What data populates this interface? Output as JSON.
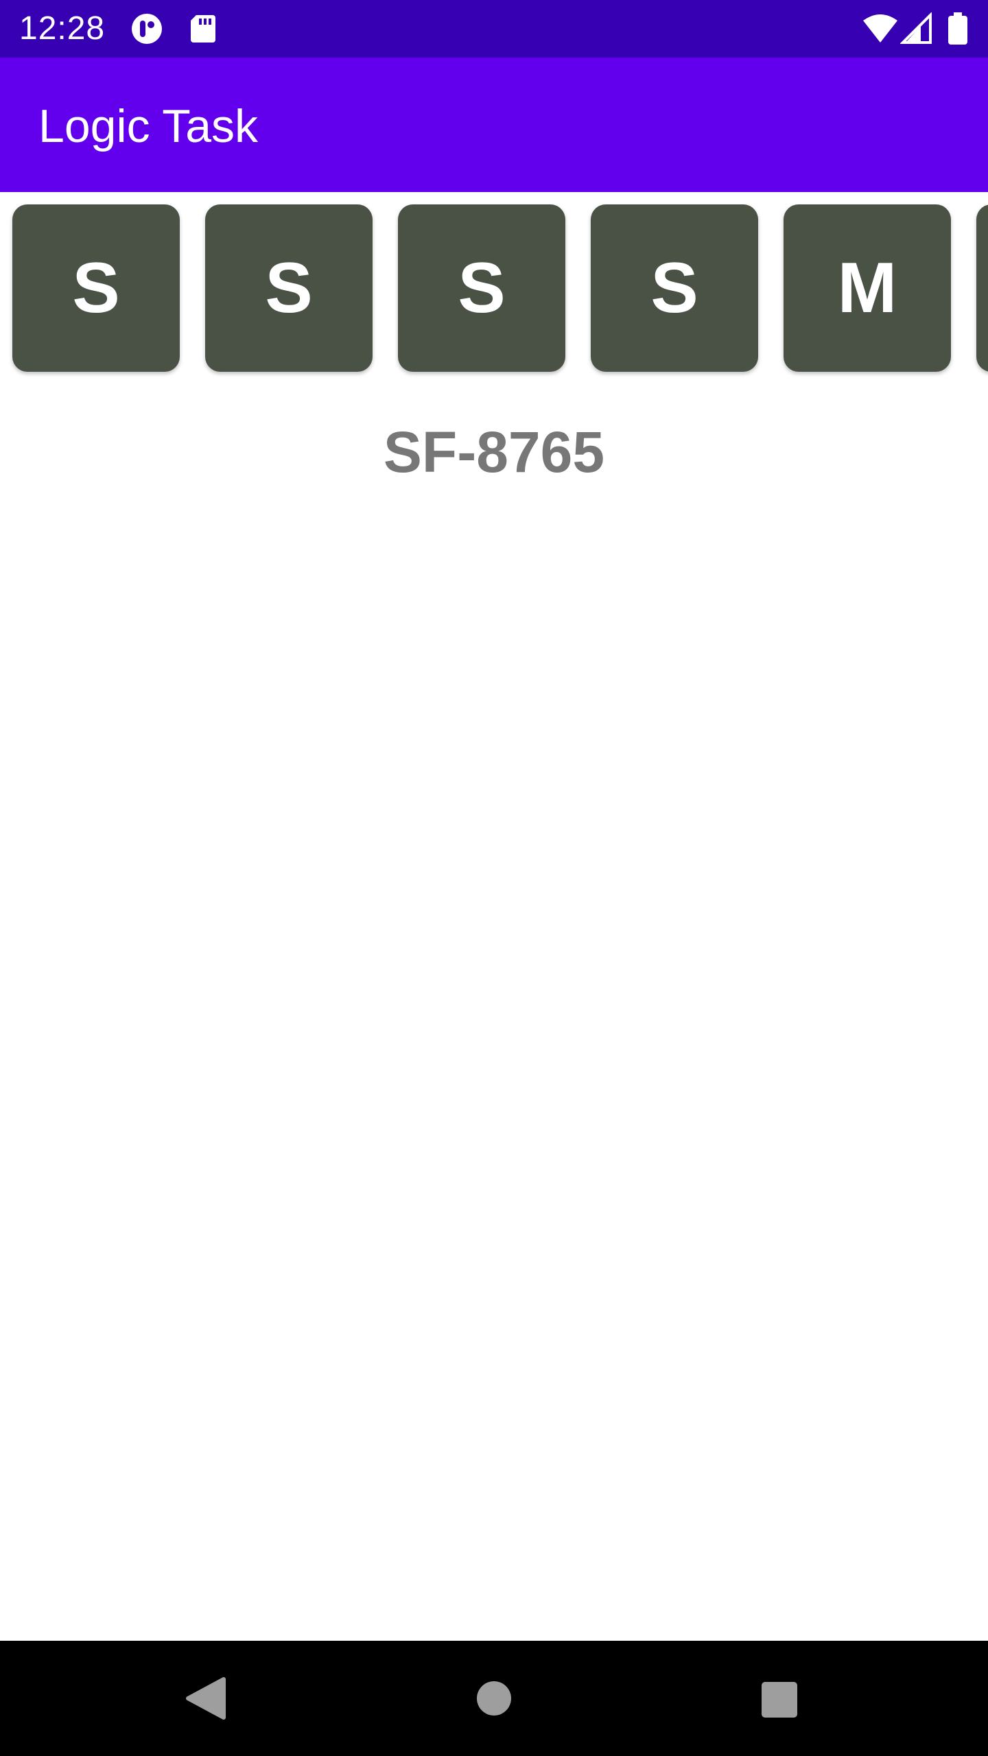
{
  "status_bar": {
    "time": "12:28",
    "icons": [
      "notification-app-icon",
      "sd-card-icon",
      "wifi-icon",
      "cell-signal-icon",
      "battery-icon"
    ]
  },
  "app_bar": {
    "title": "Logic Task"
  },
  "tiles": [
    {
      "letter": "S"
    },
    {
      "letter": "S"
    },
    {
      "letter": "S"
    },
    {
      "letter": "S"
    },
    {
      "letter": "M"
    },
    {
      "letter": ""
    }
  ],
  "code_label": "SF-8765",
  "nav_bar": {
    "buttons": [
      "back",
      "home",
      "recents"
    ]
  },
  "colors": {
    "status_bar": "#3700b3",
    "app_bar": "#6200ee",
    "tile": "#4a5246",
    "code_text": "#777777"
  }
}
